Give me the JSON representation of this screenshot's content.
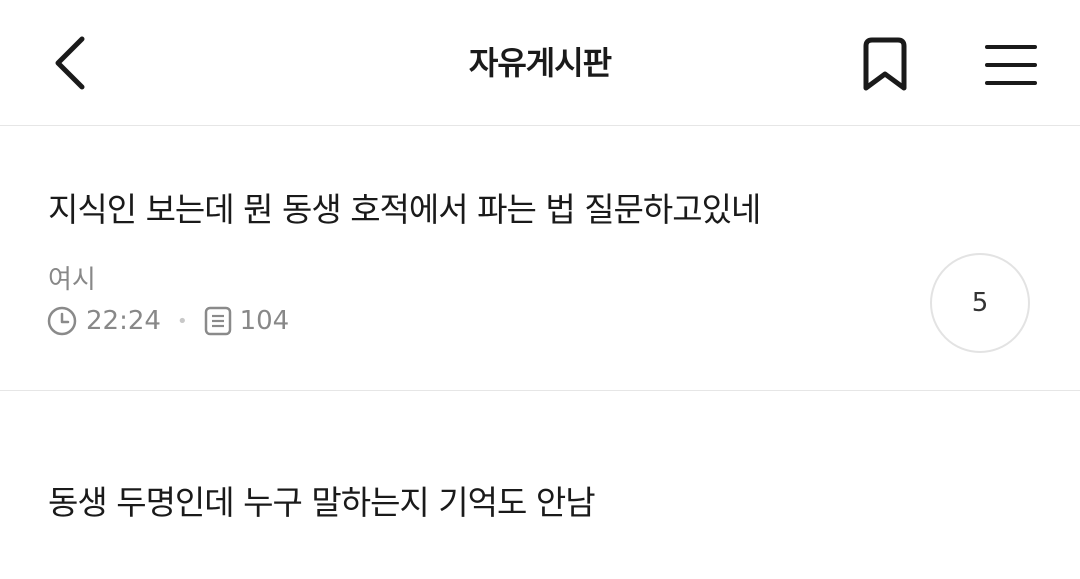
{
  "header": {
    "title": "자유게시판",
    "back_icon": "chevron-left-icon",
    "bookmark_icon": "bookmark-icon",
    "menu_icon": "hamburger-menu-icon"
  },
  "posts": [
    {
      "title": "지식인 보는데 뭔 동생 호적에서 파는 법 질문하고있네",
      "author": "여시",
      "time": "22:24",
      "views": "104",
      "comments": "5",
      "time_icon": "clock-icon",
      "views_icon": "document-icon"
    },
    {
      "title": "동생 두명인데 누구 말하는지 기억도 안남"
    }
  ]
}
